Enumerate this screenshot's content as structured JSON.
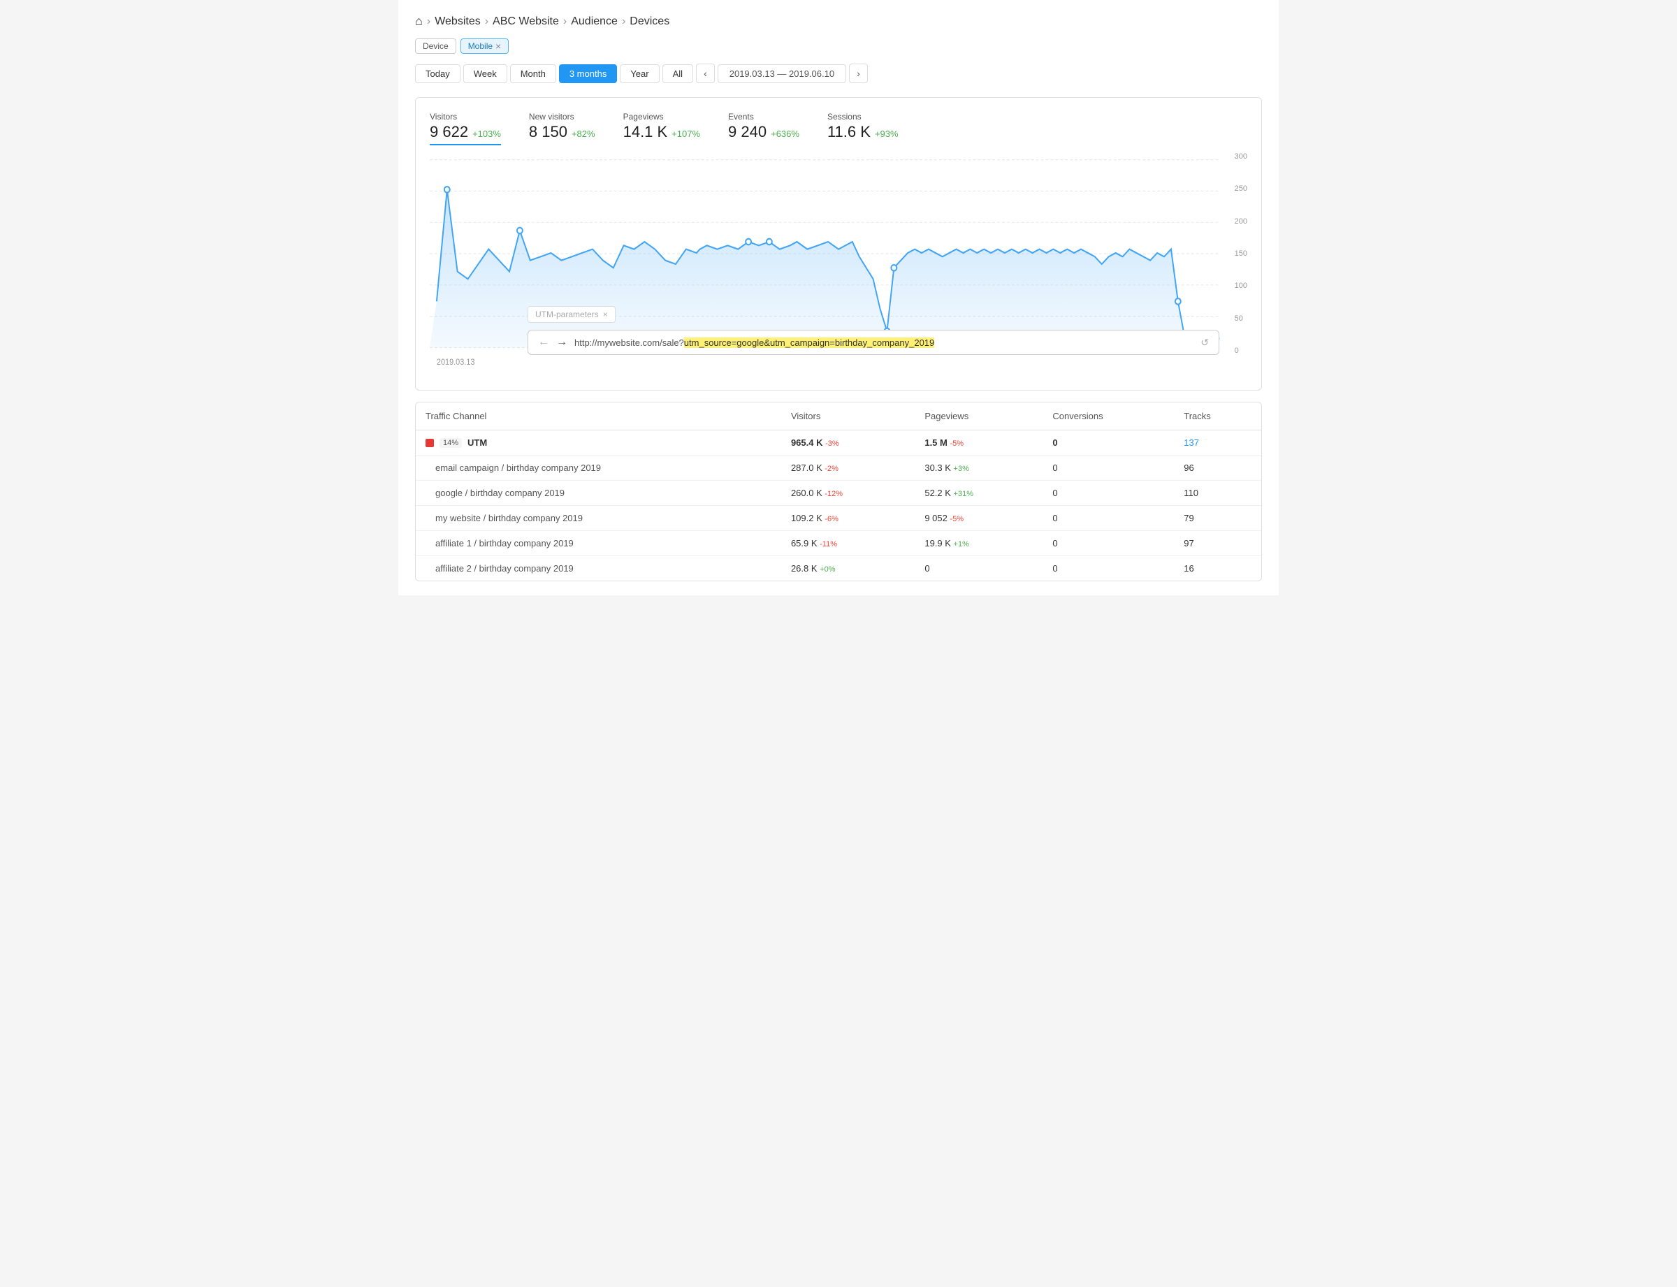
{
  "breadcrumb": {
    "items": [
      "Websites",
      "ABC Website",
      "Audience",
      "Devices"
    ]
  },
  "filters": {
    "device_label": "Device",
    "mobile_label": "Mobile"
  },
  "date_controls": {
    "buttons": [
      "Today",
      "Week",
      "Month",
      "3 months",
      "Year",
      "All"
    ],
    "active": "3 months",
    "range": "2019.03.13 — 2019.06.10"
  },
  "stats": [
    {
      "label": "Visitors",
      "value": "9 622",
      "change": "+103%",
      "pos": true,
      "underline": true
    },
    {
      "label": "New visitors",
      "value": "8 150",
      "change": "+82%",
      "pos": true
    },
    {
      "label": "Pageviews",
      "value": "14.1 K",
      "change": "+107%",
      "pos": true
    },
    {
      "label": "Events",
      "value": "9 240",
      "change": "+636%",
      "pos": true
    },
    {
      "label": "Sessions",
      "value": "11.6 K",
      "change": "+93%",
      "pos": true
    }
  ],
  "chart": {
    "x_label": "2019.03.13",
    "y_labels": [
      "300",
      "250",
      "200",
      "150",
      "100",
      "50",
      "0"
    ]
  },
  "utm_tag": "UTM-parameters",
  "url_bar": {
    "url_prefix": "http://mywebsite.com/sale?",
    "url_highlight": "utm_source=google&utm_campaign=birthday_company_2019"
  },
  "table": {
    "headers": [
      "Traffic Channel",
      "Visitors",
      "Pageviews",
      "Conversions",
      "Tracks"
    ],
    "rows": [
      {
        "type": "main",
        "color": "#e53935",
        "pct": "14%",
        "name": "UTM",
        "visitors": "965.4 K",
        "visitors_change": "-3%",
        "pageviews": "1.5 M",
        "pageviews_change": "-5%",
        "conversions": "0",
        "tracks": "137",
        "tracks_link": true
      },
      {
        "type": "sub",
        "name": "email campaign / birthday company 2019",
        "visitors": "287.0 K",
        "visitors_change": "-2%",
        "pageviews": "30.3 K",
        "pageviews_change": "+3%",
        "conversions": "0",
        "tracks": "96",
        "tracks_link": false
      },
      {
        "type": "sub",
        "name": "google / birthday company 2019",
        "visitors": "260.0 K",
        "visitors_change": "-12%",
        "pageviews": "52.2 K",
        "pageviews_change": "+31%",
        "conversions": "0",
        "tracks": "110",
        "tracks_link": false
      },
      {
        "type": "sub",
        "name": "my website / birthday company 2019",
        "visitors": "109.2 K",
        "visitors_change": "-6%",
        "pageviews": "9 052",
        "pageviews_change": "-5%",
        "conversions": "0",
        "tracks": "79",
        "tracks_link": false
      },
      {
        "type": "sub",
        "name": "affiliate 1 / birthday company 2019",
        "visitors": "65.9 K",
        "visitors_change": "-11%",
        "pageviews": "19.9 K",
        "pageviews_change": "+1%",
        "conversions": "0",
        "tracks": "97",
        "tracks_link": false
      },
      {
        "type": "sub",
        "name": "affiliate 2 / birthday company 2019",
        "visitors": "26.8 K",
        "visitors_change": "+0%",
        "pageviews": "0",
        "pageviews_change": "",
        "conversions": "0",
        "tracks": "16",
        "tracks_link": false
      }
    ]
  }
}
